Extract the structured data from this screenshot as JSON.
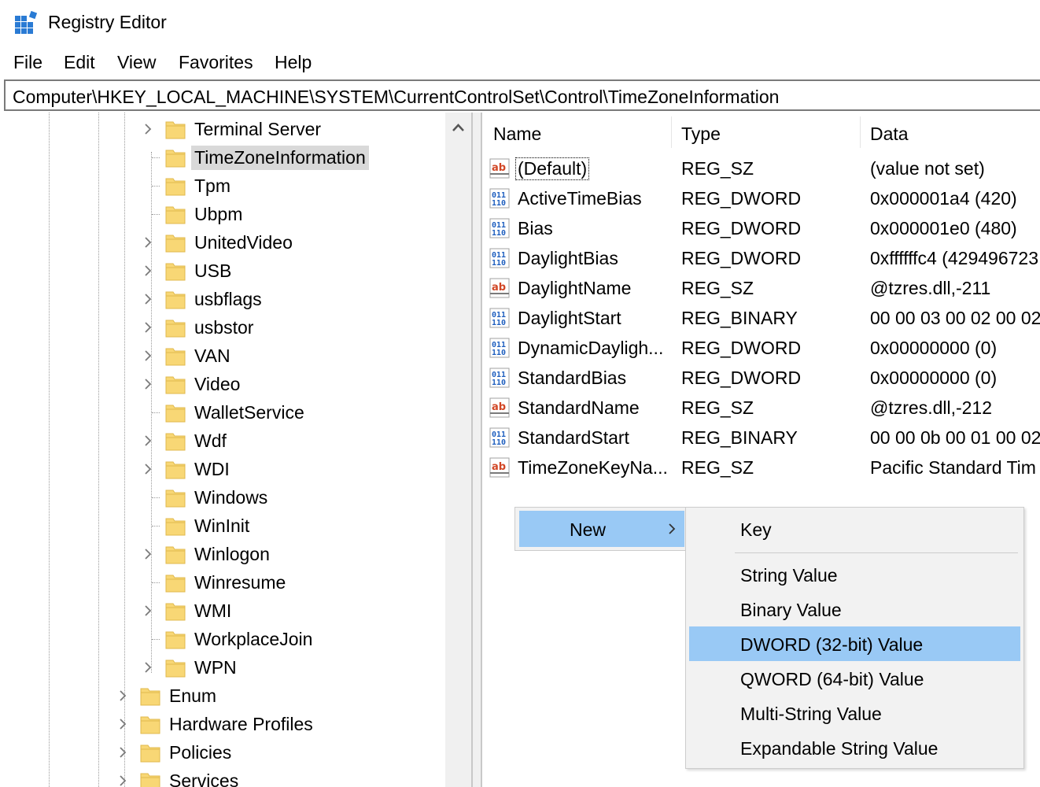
{
  "window": {
    "title": "Registry Editor"
  },
  "menu": [
    "File",
    "Edit",
    "View",
    "Favorites",
    "Help"
  ],
  "address": "Computer\\HKEY_LOCAL_MACHINE\\SYSTEM\\CurrentControlSet\\Control\\TimeZoneInformation",
  "tree": [
    {
      "label": "Terminal Server",
      "expandable": true,
      "level": 2
    },
    {
      "label": "TimeZoneInformation",
      "expandable": false,
      "level": 2,
      "selected": true
    },
    {
      "label": "Tpm",
      "expandable": false,
      "level": 2
    },
    {
      "label": "Ubpm",
      "expandable": false,
      "level": 2
    },
    {
      "label": "UnitedVideo",
      "expandable": true,
      "level": 2
    },
    {
      "label": "USB",
      "expandable": true,
      "level": 2
    },
    {
      "label": "usbflags",
      "expandable": true,
      "level": 2
    },
    {
      "label": "usbstor",
      "expandable": true,
      "level": 2
    },
    {
      "label": "VAN",
      "expandable": true,
      "level": 2
    },
    {
      "label": "Video",
      "expandable": true,
      "level": 2
    },
    {
      "label": "WalletService",
      "expandable": false,
      "level": 2
    },
    {
      "label": "Wdf",
      "expandable": true,
      "level": 2
    },
    {
      "label": "WDI",
      "expandable": true,
      "level": 2
    },
    {
      "label": "Windows",
      "expandable": false,
      "level": 2
    },
    {
      "label": "WinInit",
      "expandable": false,
      "level": 2
    },
    {
      "label": "Winlogon",
      "expandable": true,
      "level": 2
    },
    {
      "label": "Winresume",
      "expandable": false,
      "level": 2
    },
    {
      "label": "WMI",
      "expandable": true,
      "level": 2
    },
    {
      "label": "WorkplaceJoin",
      "expandable": false,
      "level": 2
    },
    {
      "label": "WPN",
      "expandable": true,
      "level": 2
    },
    {
      "label": "Enum",
      "expandable": true,
      "level": 1
    },
    {
      "label": "Hardware Profiles",
      "expandable": true,
      "level": 1
    },
    {
      "label": "Policies",
      "expandable": true,
      "level": 1
    },
    {
      "label": "Services",
      "expandable": true,
      "level": 1
    }
  ],
  "columns": {
    "name": "Name",
    "type": "Type",
    "data": "Data"
  },
  "values": [
    {
      "name": "(Default)",
      "type": "REG_SZ",
      "data": "(value not set)",
      "icon": "string-value-icon"
    },
    {
      "name": "ActiveTimeBias",
      "type": "REG_DWORD",
      "data": "0x000001a4 (420)",
      "icon": "binary-value-icon"
    },
    {
      "name": "Bias",
      "type": "REG_DWORD",
      "data": "0x000001e0 (480)",
      "icon": "binary-value-icon"
    },
    {
      "name": "DaylightBias",
      "type": "REG_DWORD",
      "data": "0xffffffc4 (429496723",
      "icon": "binary-value-icon"
    },
    {
      "name": "DaylightName",
      "type": "REG_SZ",
      "data": "@tzres.dll,-211",
      "icon": "string-value-icon"
    },
    {
      "name": "DaylightStart",
      "type": "REG_BINARY",
      "data": "00 00 03 00 02 00 02 0",
      "icon": "binary-value-icon"
    },
    {
      "name": "DynamicDayligh...",
      "type": "REG_DWORD",
      "data": "0x00000000 (0)",
      "icon": "binary-value-icon"
    },
    {
      "name": "StandardBias",
      "type": "REG_DWORD",
      "data": "0x00000000 (0)",
      "icon": "binary-value-icon"
    },
    {
      "name": "StandardName",
      "type": "REG_SZ",
      "data": "@tzres.dll,-212",
      "icon": "string-value-icon"
    },
    {
      "name": "StandardStart",
      "type": "REG_BINARY",
      "data": "00 00 0b 00 01 00 02 0",
      "icon": "binary-value-icon"
    },
    {
      "name": "TimeZoneKeyNa...",
      "type": "REG_SZ",
      "data": "Pacific Standard Tim",
      "icon": "string-value-icon"
    }
  ],
  "context_menu": {
    "new_label": "New",
    "submenu": [
      "Key",
      "String Value",
      "Binary Value",
      "DWORD (32-bit) Value",
      "QWORD (64-bit) Value",
      "Multi-String Value",
      "Expandable String Value"
    ],
    "highlighted": "DWORD (32-bit) Value"
  },
  "colors": {
    "highlight": "#99c9f5",
    "selection": "#d9d9d9",
    "folder": "#f8d775",
    "folder_edge": "#e0b94d"
  }
}
